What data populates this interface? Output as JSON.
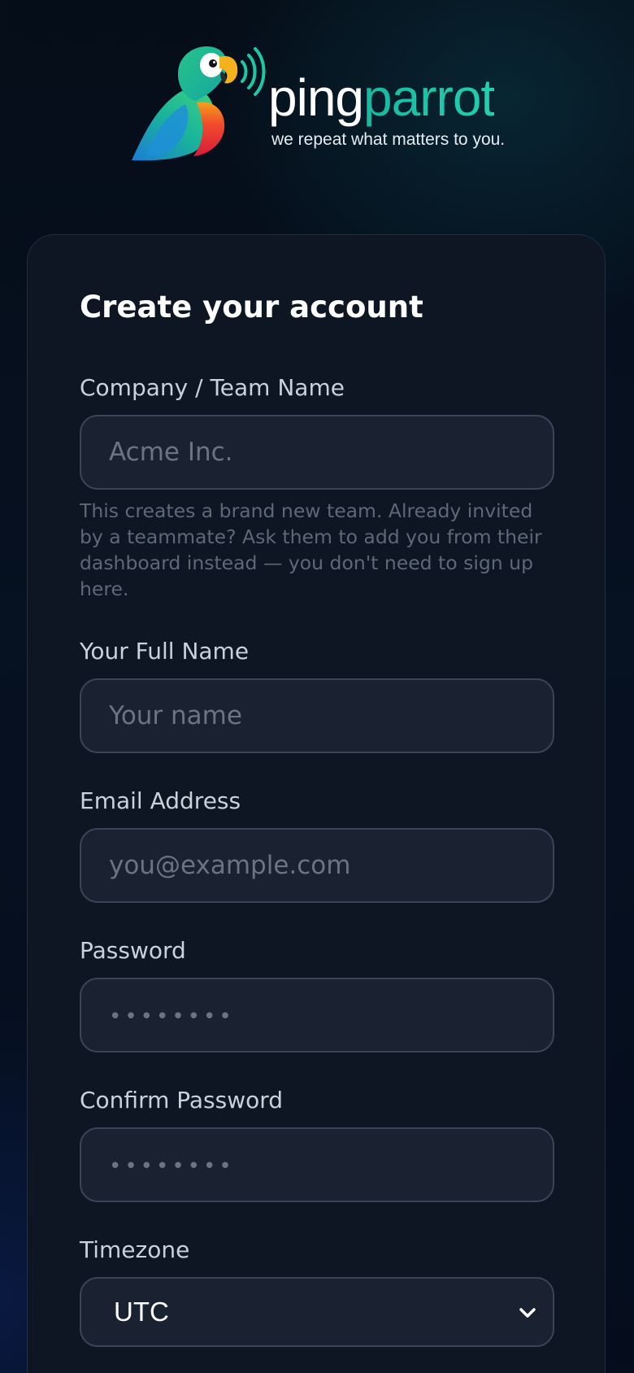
{
  "brand": {
    "name_part1": "ping",
    "name_part2": "parrot",
    "tagline": "we repeat what matters to you.",
    "colors": {
      "accent": "#1ec8a6",
      "background": "#061121",
      "card": "#0e1624",
      "input": "#1a2232"
    }
  },
  "form": {
    "title": "Create your account",
    "company": {
      "label": "Company / Team Name",
      "placeholder": "Acme Inc.",
      "help": "This creates a brand new team. Already invited by a teammate? Ask them to add you from their dashboard instead — you don't need to sign up here."
    },
    "full_name": {
      "label": "Your Full Name",
      "placeholder": "Your name"
    },
    "email": {
      "label": "Email Address",
      "placeholder": "you@example.com"
    },
    "password": {
      "label": "Password",
      "placeholder": "••••••••"
    },
    "confirm_password": {
      "label": "Confirm Password",
      "placeholder": "••••••••"
    },
    "timezone": {
      "label": "Timezone",
      "value": "UTC",
      "icon": "chevron-down-icon"
    }
  }
}
